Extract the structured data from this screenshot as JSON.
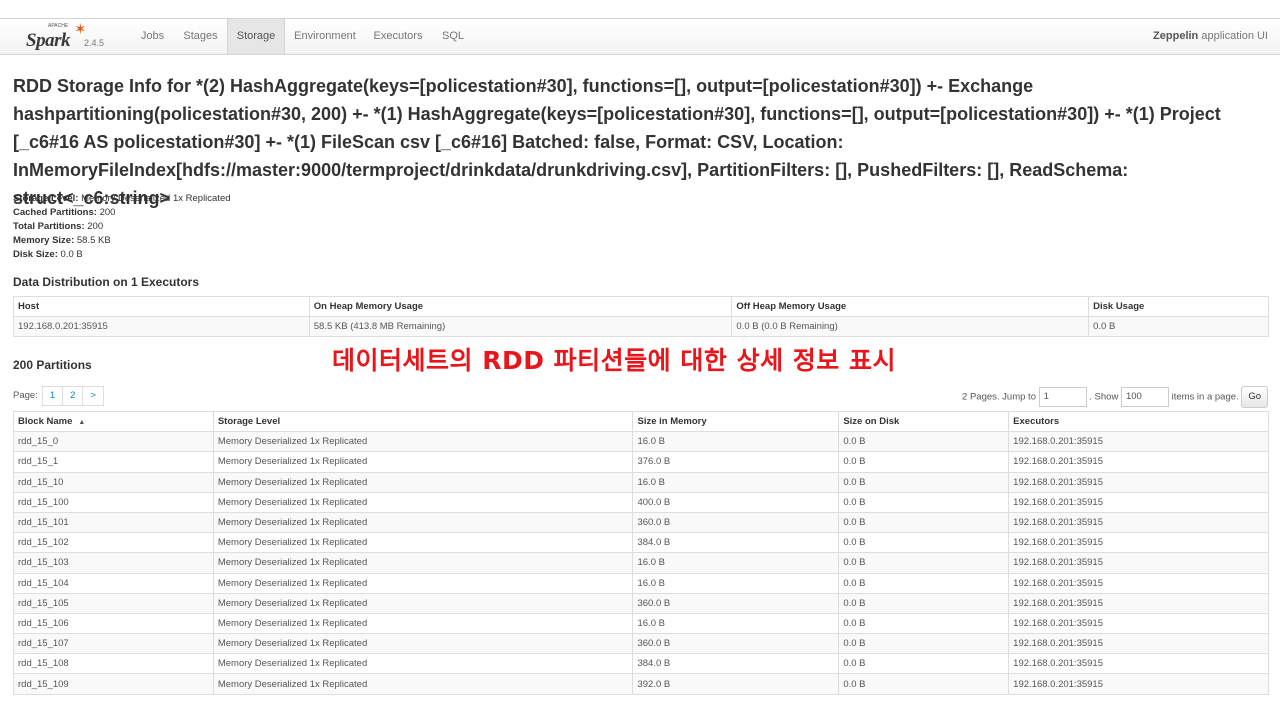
{
  "nav": {
    "apache": "APACHE",
    "logo_text": "Spark",
    "version": "2.4.5",
    "tabs": [
      "Jobs",
      "Stages",
      "Storage",
      "Environment",
      "Executors",
      "SQL"
    ],
    "active_tab": "Storage",
    "app_name_bold": "Zeppelin",
    "app_name_rest": " application UI"
  },
  "title": "RDD Storage Info for *(2) HashAggregate(keys=[policestation#30], functions=[], output=[policestation#30]) +- Exchange hashpartitioning(policestation#30, 200) +- *(1) HashAggregate(keys=[policestation#30], functions=[], output=[policestation#30]) +- *(1) Project [_c6#16 AS policestation#30] +- *(1) FileScan csv [_c6#16] Batched: false, Format: CSV, Location: InMemoryFileIndex[hdfs://master:9000/termproject/drinkdata/drunkdriving.csv], PartitionFilters: [], PushedFilters: [], ReadSchema: struct<_c6:string>",
  "summary": {
    "storage_level_label": "Storage Level:",
    "storage_level": "Memory Deserialized 1x Replicated",
    "cached_partitions_label": "Cached Partitions:",
    "cached_partitions": "200",
    "total_partitions_label": "Total Partitions:",
    "total_partitions": "200",
    "memory_size_label": "Memory Size:",
    "memory_size": "58.5 KB",
    "disk_size_label": "Disk Size:",
    "disk_size": "0.0 B"
  },
  "distribution": {
    "heading": "Data Distribution on 1 Executors",
    "columns": [
      "Host",
      "On Heap Memory Usage",
      "Off Heap Memory Usage",
      "Disk Usage"
    ],
    "row": [
      "192.168.0.201:35915",
      "58.5 KB (413.8 MB Remaining)",
      "0.0 B (0.0 B Remaining)",
      "0.0 B"
    ]
  },
  "annotation": "데이터세트의 RDD 파티션들에 대한 상세 정보 표시",
  "partitions": {
    "heading": "200 Partitions",
    "page_label": "Page:",
    "pages": [
      "1",
      "2",
      ">"
    ],
    "pages_text": "2 Pages. Jump to",
    "jump_value": "1",
    "show_text": ". Show",
    "show_value": "100",
    "items_text": "items in a page.",
    "go_label": "Go",
    "columns": [
      "Block Name",
      "Storage Level",
      "Size in Memory",
      "Size on Disk",
      "Executors"
    ],
    "sort_indicator": "▲",
    "rows": [
      [
        "rdd_15_0",
        "Memory Deserialized 1x Replicated",
        "16.0 B",
        "0.0 B",
        "192.168.0.201:35915"
      ],
      [
        "rdd_15_1",
        "Memory Deserialized 1x Replicated",
        "376.0 B",
        "0.0 B",
        "192.168.0.201:35915"
      ],
      [
        "rdd_15_10",
        "Memory Deserialized 1x Replicated",
        "16.0 B",
        "0.0 B",
        "192.168.0.201:35915"
      ],
      [
        "rdd_15_100",
        "Memory Deserialized 1x Replicated",
        "400.0 B",
        "0.0 B",
        "192.168.0.201:35915"
      ],
      [
        "rdd_15_101",
        "Memory Deserialized 1x Replicated",
        "360.0 B",
        "0.0 B",
        "192.168.0.201:35915"
      ],
      [
        "rdd_15_102",
        "Memory Deserialized 1x Replicated",
        "384.0 B",
        "0.0 B",
        "192.168.0.201:35915"
      ],
      [
        "rdd_15_103",
        "Memory Deserialized 1x Replicated",
        "16.0 B",
        "0.0 B",
        "192.168.0.201:35915"
      ],
      [
        "rdd_15_104",
        "Memory Deserialized 1x Replicated",
        "16.0 B",
        "0.0 B",
        "192.168.0.201:35915"
      ],
      [
        "rdd_15_105",
        "Memory Deserialized 1x Replicated",
        "360.0 B",
        "0.0 B",
        "192.168.0.201:35915"
      ],
      [
        "rdd_15_106",
        "Memory Deserialized 1x Replicated",
        "16.0 B",
        "0.0 B",
        "192.168.0.201:35915"
      ],
      [
        "rdd_15_107",
        "Memory Deserialized 1x Replicated",
        "360.0 B",
        "0.0 B",
        "192.168.0.201:35915"
      ],
      [
        "rdd_15_108",
        "Memory Deserialized 1x Replicated",
        "384.0 B",
        "0.0 B",
        "192.168.0.201:35915"
      ],
      [
        "rdd_15_109",
        "Memory Deserialized 1x Replicated",
        "392.0 B",
        "0.0 B",
        "192.168.0.201:35915"
      ]
    ]
  }
}
